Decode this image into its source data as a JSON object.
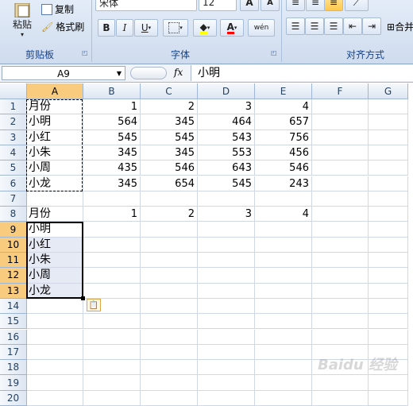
{
  "ribbon": {
    "clipboard": {
      "paste_label": "粘贴",
      "copy_label": "复制",
      "format_painter_label": "格式刷",
      "group_label": "剪贴板"
    },
    "font": {
      "font_name": "宋体",
      "font_size": "12",
      "bold": "B",
      "italic": "I",
      "underline": "U",
      "group_label": "字体",
      "phonetic": "wén"
    },
    "alignment": {
      "group_label": "对齐方式",
      "merge_label": "合并"
    }
  },
  "formula_bar": {
    "name_box": "A9",
    "fx_label": "fx",
    "content": "小明"
  },
  "columns": [
    "A",
    "B",
    "C",
    "D",
    "E",
    "F",
    "G"
  ],
  "rows": [
    "1",
    "2",
    "3",
    "4",
    "5",
    "6",
    "7",
    "8",
    "9",
    "10",
    "11",
    "12",
    "13",
    "14",
    "15",
    "16",
    "17",
    "18",
    "19",
    "20"
  ],
  "cells": {
    "r1": [
      "月份",
      "1",
      "2",
      "3",
      "4"
    ],
    "r2": [
      "小明",
      "564",
      "345",
      "464",
      "657"
    ],
    "r3": [
      "小红",
      "545",
      "545",
      "543",
      "756"
    ],
    "r4": [
      "小朱",
      "345",
      "345",
      "553",
      "456"
    ],
    "r5": [
      "小周",
      "435",
      "546",
      "643",
      "546"
    ],
    "r6": [
      "小龙",
      "345",
      "654",
      "545",
      "243"
    ],
    "r8": [
      "月份",
      "1",
      "2",
      "3",
      "4"
    ],
    "r9": [
      "小明"
    ],
    "r10": [
      "小红"
    ],
    "r11": [
      "小朱"
    ],
    "r12": [
      "小周"
    ],
    "r13": [
      "小龙"
    ]
  },
  "selection": {
    "active_cell": "A9",
    "range": "A9:A13",
    "copy_range": "A1:A6"
  },
  "paste_options_icon": "clipboard-paste-icon",
  "watermark": "Baidu 经验"
}
